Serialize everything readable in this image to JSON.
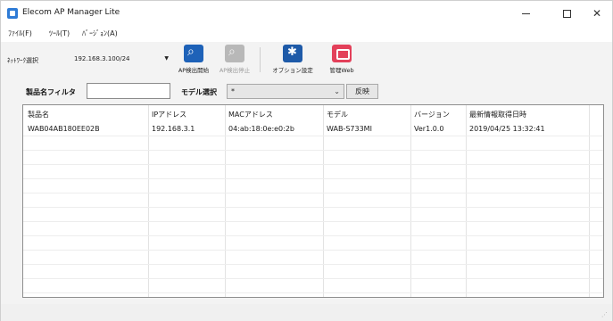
{
  "window": {
    "title": "Elecom AP Manager Lite",
    "controls": {
      "minimize_icon": "minimize-icon",
      "maximize_icon": "maximize-icon",
      "close_glyph": "✕"
    }
  },
  "menu": [
    {
      "label": "ﾌｧｲﾙ(F)"
    },
    {
      "label": "ﾂｰﾙ(T)"
    },
    {
      "label": "ﾊﾞｰｼﾞｮﾝ(A)"
    }
  ],
  "toolbar": {
    "network_label": "ﾈｯﾄﾜｰｸ選択",
    "network_value": "192.168.3.100/24",
    "buttons": [
      {
        "label": "AP検出開始",
        "icon": "search-ap-icon",
        "enabled": true
      },
      {
        "label": "AP検出停止",
        "icon": "stop-search-icon",
        "enabled": false
      },
      {
        "label": "オプション設定",
        "icon": "gear-icon",
        "enabled": true
      },
      {
        "label": "管理Web",
        "icon": "web-admin-icon",
        "enabled": true
      }
    ]
  },
  "filter": {
    "product_label": "製品名フィルタ",
    "product_value": "",
    "model_label": "モデル選択",
    "model_value": "*",
    "apply_label": "反映"
  },
  "table": {
    "columns": [
      "製品名",
      "IPアドレス",
      "MACアドレス",
      "モデル",
      "バージョン",
      "最新情報取得日時"
    ],
    "rows": [
      [
        "WAB04AB180EE02B",
        "192.168.3.1",
        "04:ab:18:0e:e0:2b",
        "WAB-S733MI",
        "Ver1.0.0",
        "2019/04/25 13:32:41"
      ]
    ]
  },
  "colors": {
    "accent": "#1e62b8",
    "web_button": "#e3405a"
  }
}
